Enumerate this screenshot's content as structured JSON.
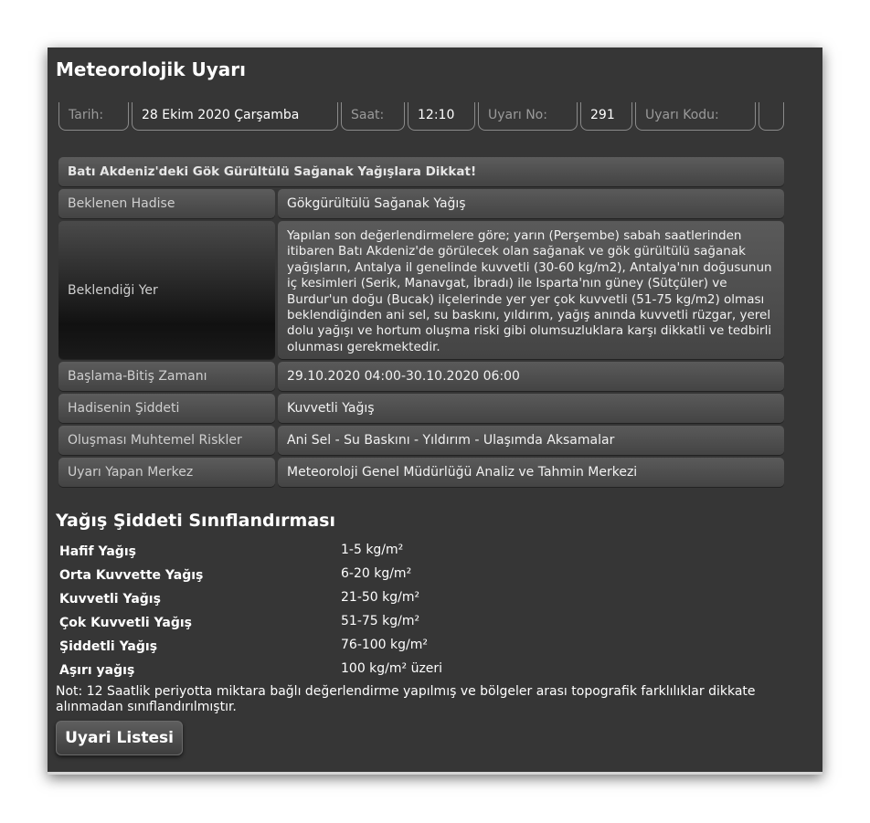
{
  "page": {
    "title": "Meteorolojik Uyarı"
  },
  "header": {
    "date_label": "Tarih:",
    "date_value": "28 Ekim 2020 Çarşamba",
    "time_label": "Saat:",
    "time_value": "12:10",
    "warning_no_label": "Uyarı No:",
    "warning_no_value": "291",
    "warning_code_label": "Uyarı Kodu:",
    "warning_code_value": ""
  },
  "warning": {
    "headline": "Batı Akdeniz'deki Gök Gürültülü Sağanak Yağışlara Dikkat!",
    "rows": {
      "event": {
        "label": "Beklenen Hadise",
        "value": "Gökgürültülü Sağanak Yağış"
      },
      "location": {
        "label": "Beklendiği Yer",
        "value": "Yapılan son değerlendirmelere göre; yarın (Perşembe) sabah saatlerinden itibaren Batı Akdeniz'de görülecek olan sağanak ve gök gürültülü sağanak yağışların, Antalya il genelinde kuvvetli (30-60 kg/m2), Antalya'nın doğusunun iç kesimleri (Serik, Manavgat, İbradı) ile Isparta'nın güney (Sütçüler) ve Burdur'un doğu (Bucak) ilçelerinde yer yer çok kuvvetli (51-75 kg/m2) olması beklendiğinden ani sel, su baskını, yıldırım, yağış anında kuvvetli rüzgar, yerel dolu yağışı ve hortum oluşma riski gibi olumsuzluklara karşı dikkatli ve tedbirli olunması gerekmektedir."
      },
      "period": {
        "label": "Başlama-Bitiş Zamanı",
        "value": "29.10.2020 04:00-30.10.2020 06:00"
      },
      "severity": {
        "label": "Hadisenin Şiddeti",
        "value": "Kuvvetli Yağış"
      },
      "risks": {
        "label": "Oluşması Muhtemel Riskler",
        "value": "Ani Sel - Su Baskını - Yıldırım - Ulaşımda Aksamalar"
      },
      "center": {
        "label": "Uyarı Yapan Merkez",
        "value": "Meteoroloji Genel Müdürlüğü Analiz ve Tahmin Merkezi"
      }
    }
  },
  "classification": {
    "title": "Yağış Şiddeti Sınıflandırması",
    "items": [
      {
        "name": "Hafif Yağış",
        "range": "1-5 kg/m²"
      },
      {
        "name": "Orta Kuvvette Yağış",
        "range": "6-20 kg/m²"
      },
      {
        "name": "Kuvvetli Yağış",
        "range": "21-50 kg/m²"
      },
      {
        "name": "Çok Kuvvetli Yağış",
        "range": "51-75 kg/m²"
      },
      {
        "name": "Şiddetli Yağış",
        "range": "76-100 kg/m²"
      },
      {
        "name": "Aşırı yağış",
        "range": "100 kg/m² üzeri"
      }
    ],
    "note": "Not: 12 Saatlik periyotta miktara bağlı değerlendirme yapılmış ve bölgeler arası topografik farklılıklar dikkate alınmadan sınıflandırılmıştır."
  },
  "buttons": {
    "list_label": "Uyari Listesi"
  }
}
